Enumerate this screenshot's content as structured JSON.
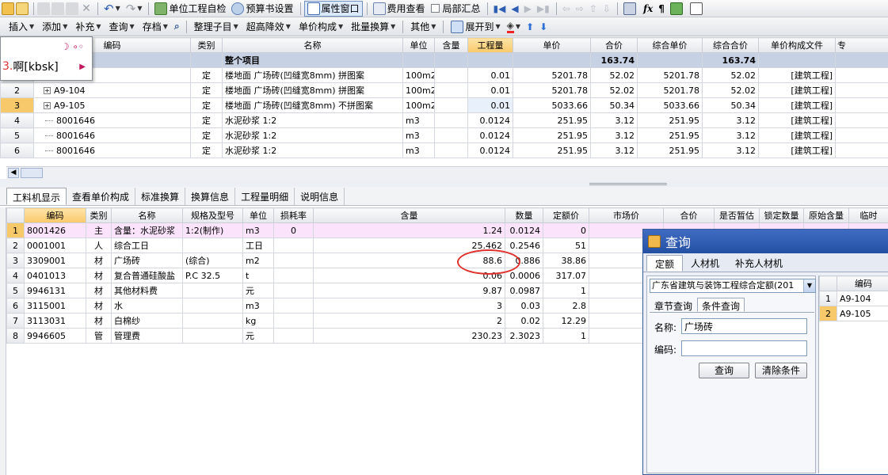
{
  "toolbar1": {
    "self_check": "单位工程自检",
    "budget_settings": "预算书设置",
    "property_window": "属性窗口",
    "fee_view": "费用查看",
    "partial_summary": "局部汇总"
  },
  "toolbar2": {
    "insert": "插入",
    "add": "添加",
    "supplement": "补充",
    "query": "查询",
    "archive": "存档",
    "organize": "整理子目",
    "height_reduction": "超高降效",
    "unit_price_comp": "单价构成",
    "batch_convert": "批量换算",
    "other": "其他",
    "expand_to": "展开到"
  },
  "ime_popup": {
    "candidate_number": "3.",
    "candidate_text": "啊[kbsk]"
  },
  "top_table": {
    "headers": [
      "",
      "编码",
      "类别",
      "名称",
      "单位",
      "含量",
      "工程量",
      "单价",
      "合价",
      "综合单价",
      "综合合价",
      "单价构成文件",
      "专"
    ],
    "total_row": {
      "name": "整个项目",
      "sum_price": "163.74",
      "composite_total": "163.74"
    },
    "rows": [
      {
        "num": "1",
        "code": "A9-104",
        "type": "定",
        "name": "楼地面 广场砖(凹缝宽8mm) 拼图案",
        "unit": "100m2",
        "content": "",
        "qty": "0.01",
        "price": "5201.78",
        "total": "52.02",
        "comp_price": "5201.78",
        "comp_total": "52.02",
        "file": "[建筑工程]"
      },
      {
        "num": "2",
        "code": "A9-104",
        "type": "定",
        "name": "楼地面 广场砖(凹缝宽8mm) 拼图案",
        "unit": "100m2",
        "content": "",
        "qty": "0.01",
        "price": "5201.78",
        "total": "52.02",
        "comp_price": "5201.78",
        "comp_total": "52.02",
        "file": "[建筑工程]"
      },
      {
        "num": "3",
        "code": "A9-105",
        "type": "定",
        "name": "楼地面 广场砖(凹缝宽8mm) 不拼图案",
        "unit": "100m2",
        "content": "",
        "qty": "0.01",
        "price": "5033.66",
        "total": "50.34",
        "comp_price": "5033.66",
        "comp_total": "50.34",
        "file": "[建筑工程]"
      },
      {
        "num": "4",
        "code": "8001646",
        "type": "定",
        "name": "水泥砂浆 1:2",
        "unit": "m3",
        "content": "",
        "qty": "0.0124",
        "price": "251.95",
        "total": "3.12",
        "comp_price": "251.95",
        "comp_total": "3.12",
        "file": "[建筑工程]"
      },
      {
        "num": "5",
        "code": "8001646",
        "type": "定",
        "name": "水泥砂浆 1:2",
        "unit": "m3",
        "content": "",
        "qty": "0.0124",
        "price": "251.95",
        "total": "3.12",
        "comp_price": "251.95",
        "comp_total": "3.12",
        "file": "[建筑工程]"
      },
      {
        "num": "6",
        "code": "8001646",
        "type": "定",
        "name": "水泥砂浆 1:2",
        "unit": "m3",
        "content": "",
        "qty": "0.0124",
        "price": "251.95",
        "total": "3.12",
        "comp_price": "251.95",
        "comp_total": "3.12",
        "file": "[建筑工程]"
      }
    ]
  },
  "bottom_tabs": [
    "工料机显示",
    "查看单价构成",
    "标准换算",
    "换算信息",
    "工程量明细",
    "说明信息"
  ],
  "bottom_table": {
    "headers": [
      "",
      "编码",
      "类别",
      "名称",
      "规格及型号",
      "单位",
      "损耗率",
      "含量",
      "数量",
      "定额价",
      "市场价",
      "合价",
      "是否暂估",
      "锁定数量",
      "原始含量",
      "临时"
    ],
    "rows": [
      {
        "num": "1",
        "code": "8001426",
        "type": "主",
        "name": "含量：水泥砂浆",
        "spec": "1:2(制作)",
        "unit": "m3",
        "loss": "0",
        "content": "1.24",
        "qty": "0.0124",
        "quota": "0"
      },
      {
        "num": "2",
        "code": "0001001",
        "type": "人",
        "name": "综合工日",
        "spec": "",
        "unit": "工日",
        "loss": "",
        "content": "25.462",
        "qty": "0.2546",
        "quota": "51"
      },
      {
        "num": "3",
        "code": "3309001",
        "type": "材",
        "name": "广场砖",
        "spec": "(综合)",
        "unit": "m2",
        "loss": "",
        "content": "88.6",
        "qty": "0.886",
        "quota": "38.86"
      },
      {
        "num": "4",
        "code": "0401013",
        "type": "材",
        "name": "复合普通硅酸盐",
        "spec": "P.C 32.5",
        "unit": "t",
        "loss": "",
        "content": "0.06",
        "qty": "0.0006",
        "quota": "317.07"
      },
      {
        "num": "5",
        "code": "9946131",
        "type": "材",
        "name": "其他材料费",
        "spec": "",
        "unit": "元",
        "loss": "",
        "content": "9.87",
        "qty": "0.0987",
        "quota": "1"
      },
      {
        "num": "6",
        "code": "3115001",
        "type": "材",
        "name": "水",
        "spec": "",
        "unit": "m3",
        "loss": "",
        "content": "3",
        "qty": "0.03",
        "quota": "2.8"
      },
      {
        "num": "7",
        "code": "3113031",
        "type": "材",
        "name": "白棉纱",
        "spec": "",
        "unit": "kg",
        "loss": "",
        "content": "2",
        "qty": "0.02",
        "quota": "12.29"
      },
      {
        "num": "8",
        "code": "9946605",
        "type": "管",
        "name": "管理费",
        "spec": "",
        "unit": "元",
        "loss": "",
        "content": "230.23",
        "qty": "2.3023",
        "quota": "1"
      }
    ]
  },
  "query_dialog": {
    "title": "查询",
    "tabs": [
      "定额",
      "人材机",
      "补充人材机"
    ],
    "combo_value": "广东省建筑与装饰工程综合定额(201",
    "subtabs": [
      "章节查询",
      "条件查询"
    ],
    "name_label": "名称:",
    "name_value": "广场砖",
    "code_label": "编码:",
    "code_value": "",
    "search_button": "查询",
    "clear_button": "清除条件",
    "result_header": "编码",
    "results": [
      {
        "num": "1",
        "code": "A9-104"
      },
      {
        "num": "2",
        "code": "A9-105"
      }
    ]
  },
  "colors": {
    "selected_header": "#f8c96a",
    "total_row": "#c7d1e4",
    "dialog_title": "#2450a4",
    "annotation_circle": "#e0302c"
  }
}
